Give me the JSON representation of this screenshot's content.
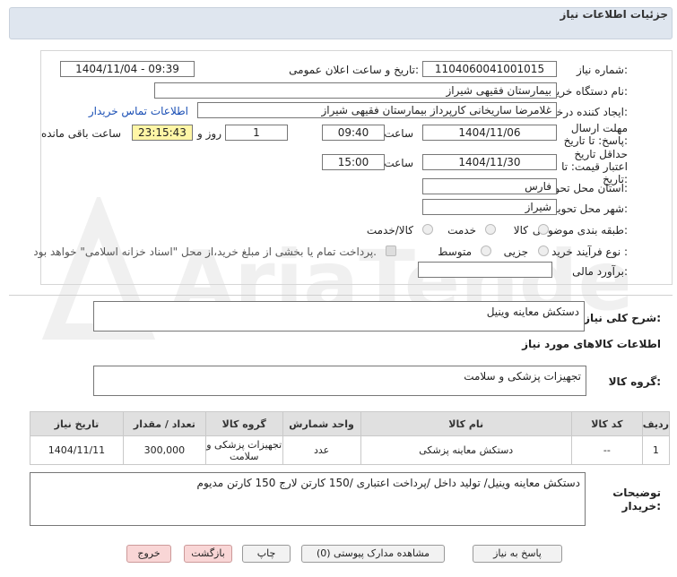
{
  "header": {
    "title": "جزئیات اطلاعات نیاز"
  },
  "form": {
    "need_number_label": "شماره نیاز:",
    "need_number": "1104060041001015",
    "announce_label": "تاریخ و ساعت اعلان عمومی:",
    "announce_value": "1404/11/04 - 09:39",
    "buyer_org_label": "نام دستگاه خریدار:",
    "buyer_org": "بیمارستان فقیهی شیراز",
    "creator_label": "ایجاد کننده درخواست:",
    "creator": "غلامرضا ساریخانی کارپرداز بیمارستان فقیهی شیراز",
    "contact_link": "اطلاعات تماس خریدار",
    "reply_deadline_label": "مهلت ارسال پاسخ: تا تاریخ:",
    "reply_date": "1404/11/06",
    "time_label": "ساعت",
    "reply_time": "09:40",
    "days_value": "1",
    "days_label": "روز و",
    "countdown": "23:15:43",
    "remaining_label": "ساعت باقی مانده",
    "price_validity_label": "حداقل تاریخ اعتبار قیمت: تا تاریخ:",
    "validity_date": "1404/11/30",
    "validity_time": "15:00",
    "province_label": "استان محل تحویل:",
    "province": "فارس",
    "city_label": "شهر محل تحویل:",
    "city": "شیراز",
    "category_label": "طبقه بندی موضوعی:",
    "category_options": [
      "کالا",
      "خدمت",
      "کالا/خدمت"
    ],
    "process_label": "نوع فرآیند خرید :",
    "process_options": [
      "جزیی",
      "متوسط"
    ],
    "payment_note": "پرداخت تمام یا بخشی از مبلغ خرید،از محل \"اسناد خزانه اسلامی\" خواهد بود.",
    "estimate_label": "برآورد مالی:",
    "estimate_value": ""
  },
  "description": {
    "label": "شرح کلی نیاز:",
    "value": "دستکش معاینه وینیل"
  },
  "goods_info": {
    "title": "اطلاعات کالاهای مورد نیاز",
    "group_label": "گروه کالا:",
    "group_value": "تجهیزات پزشکی و سلامت"
  },
  "table": {
    "headers": [
      "ردیف",
      "کد کالا",
      "نام کالا",
      "واحد شمارش",
      "گروه کالا",
      "تعداد / مقدار",
      "تاریخ نیاز"
    ],
    "rows": [
      [
        "1",
        "--",
        "دستکش معاینه پزشکی",
        "عدد",
        "تجهیزات پزشکی و سلامت",
        "300,000",
        "1404/11/11"
      ]
    ]
  },
  "buyer_notes": {
    "label": "توضیحات خریدار:",
    "value": "دستکش معاینه وینیل/ تولید داخل /پرداخت اعتباری /150 کارتن لارج 150 کارتن مدیوم"
  },
  "buttons": {
    "reply": "پاسخ به نیاز",
    "attachments": "مشاهده مدارک پیوستی (0)",
    "print": "چاپ",
    "back": "بازگشت",
    "exit": "خروج"
  },
  "watermark": "AriaTender.net",
  "colors": {
    "header_bg": "#dfe6ef",
    "timer_bg": "#fff6a6",
    "link": "#1a4fb5",
    "danger_btn": "#f9d6d6"
  }
}
